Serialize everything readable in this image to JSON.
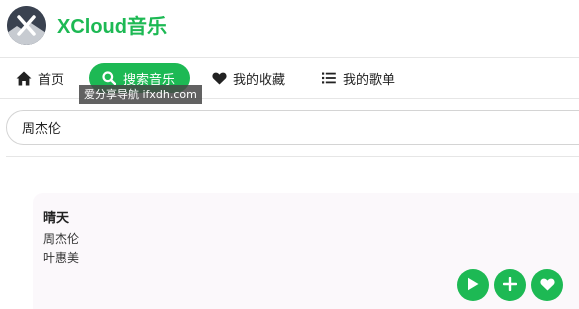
{
  "app": {
    "title": "XCloud音乐",
    "accent_color": "#1db954"
  },
  "nav": {
    "items": [
      {
        "label": "首页",
        "icon": "home-icon",
        "active": false
      },
      {
        "label": "搜索音乐",
        "icon": "search-icon",
        "active": true
      },
      {
        "label": "我的收藏",
        "icon": "heart-icon",
        "active": false
      },
      {
        "label": "我的歌单",
        "icon": "list-icon",
        "active": false
      }
    ]
  },
  "watermark": {
    "text": "爱分享导航 ifxdh.com"
  },
  "search": {
    "value": "周杰伦"
  },
  "results": [
    {
      "title": "晴天",
      "artist": "周杰伦",
      "album": "叶惠美",
      "actions": [
        "play-icon",
        "plus-icon",
        "heart-icon"
      ]
    }
  ]
}
